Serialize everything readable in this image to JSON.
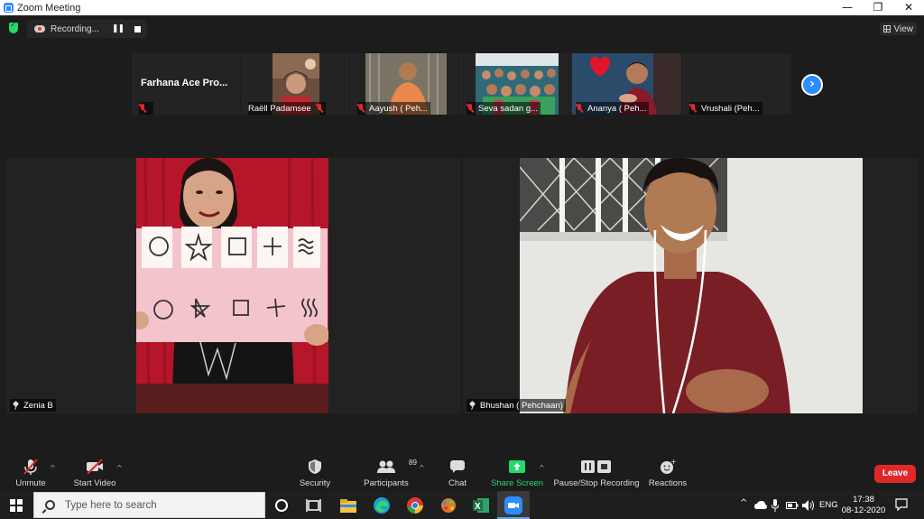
{
  "window": {
    "title": "Zoom Meeting",
    "controls": {
      "minimize": "—",
      "maximize": "❐",
      "close": "✕"
    }
  },
  "recording": {
    "label": "Recording...",
    "pause_glyph": "❚❚"
  },
  "view_button": {
    "label": "View"
  },
  "thumbnails": [
    {
      "name": "Farhana Ace Pro...",
      "display_text": "Farhana Ace Pro...",
      "muted": true
    },
    {
      "name": "Raëll Padamsee",
      "muted": true
    },
    {
      "name": "Aayush ( Peh...",
      "muted": true
    },
    {
      "name": "Seva sadan g...",
      "muted": true
    },
    {
      "name": "Ananya ( Peh...",
      "muted": true
    },
    {
      "name": "Vrushali (Peh...",
      "muted": true
    }
  ],
  "next_page_glyph": "›",
  "main_tiles": [
    {
      "name": "Zenia B"
    },
    {
      "name": "Bhushan ( Pehchaan)"
    }
  ],
  "toolbar": {
    "unmute": "Unmute",
    "start_video": "Start Video",
    "security": "Security",
    "participants": "Participants",
    "participants_count": "89",
    "chat": "Chat",
    "share_screen": "Share Screen",
    "pause_stop_recording": "Pause/Stop Recording",
    "reactions": "Reactions",
    "leave": "Leave",
    "caret": "^"
  },
  "taskbar": {
    "search_placeholder": "Type here to search",
    "language": "ENG",
    "time": "17:38",
    "date": "08-12-2020",
    "tray_caret": "^"
  },
  "colors": {
    "zoom_blue": "#2d8cff",
    "leave_red": "#e02828",
    "share_green": "#23d96c",
    "excel_green": "#1d6f42"
  }
}
